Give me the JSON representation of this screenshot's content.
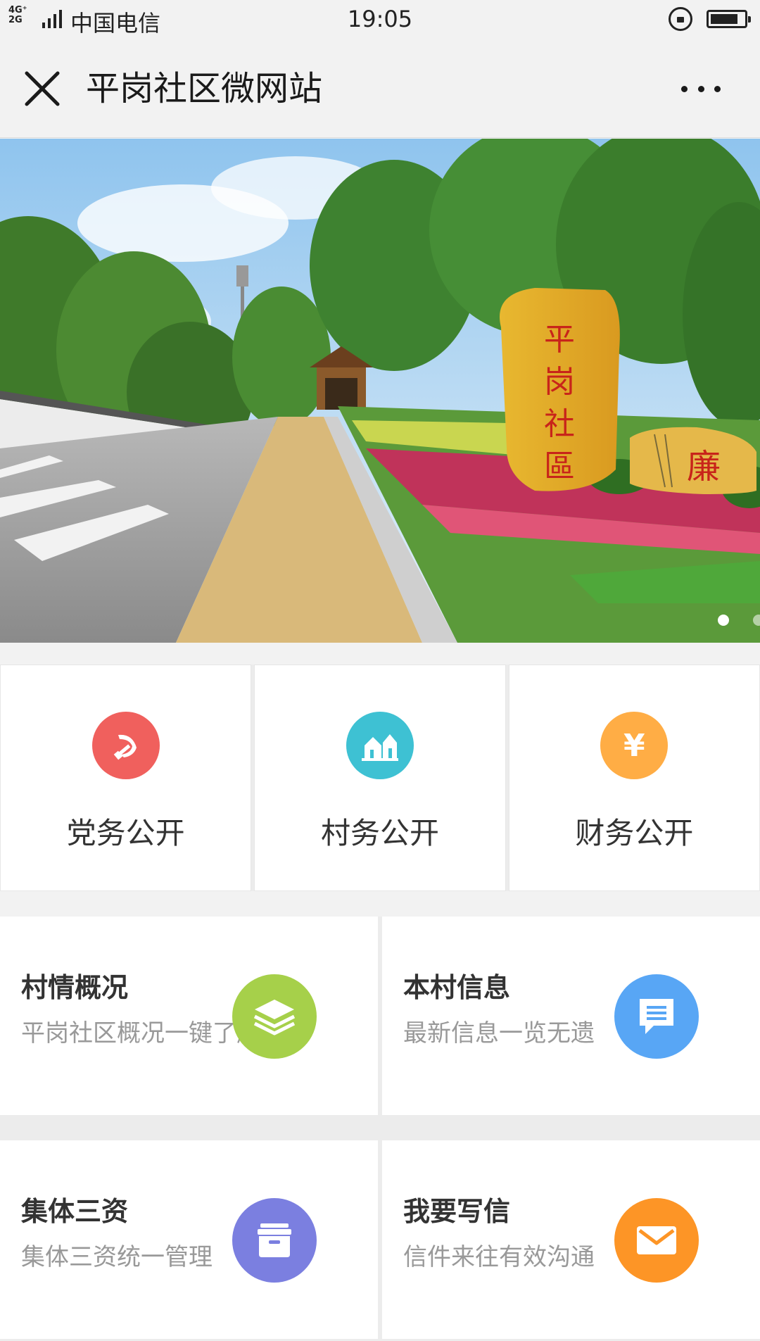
{
  "status_bar": {
    "network_top": "4G⁺",
    "network_bottom": "2G",
    "carrier": "中国电信",
    "time": "19:05"
  },
  "title_bar": {
    "close_icon": "close-icon",
    "title": "平岗社区微网站",
    "more_icon": "more-icon"
  },
  "banner": {
    "stone_text": "平岗社區",
    "small_stone_text": "廉",
    "slide_count": 2,
    "active_slide": 1
  },
  "top_cards": [
    {
      "label": "党务公开",
      "icon": "hammer-sickle-icon",
      "color": "#f0605d"
    },
    {
      "label": "村务公开",
      "icon": "village-icon",
      "color": "#3ec1d3"
    },
    {
      "label": "财务公开",
      "icon": "yen-icon",
      "color": "#ffad45"
    }
  ],
  "grid_cards": [
    {
      "title": "村情概况",
      "subtitle": "平岗社区概况一键了解",
      "icon": "layers-icon",
      "color": "#a6d04a"
    },
    {
      "title": "本村信息",
      "subtitle": "最新信息一览无遗",
      "icon": "message-icon",
      "color": "#58a6f5"
    },
    {
      "title": "集体三资",
      "subtitle": "集体三资统一管理",
      "icon": "archive-box-icon",
      "color": "#7b7fe0"
    },
    {
      "title": "我要写信",
      "subtitle": "信件来往有效沟通",
      "icon": "mail-icon",
      "color": "#fd9526"
    }
  ],
  "yen_symbol": "¥"
}
